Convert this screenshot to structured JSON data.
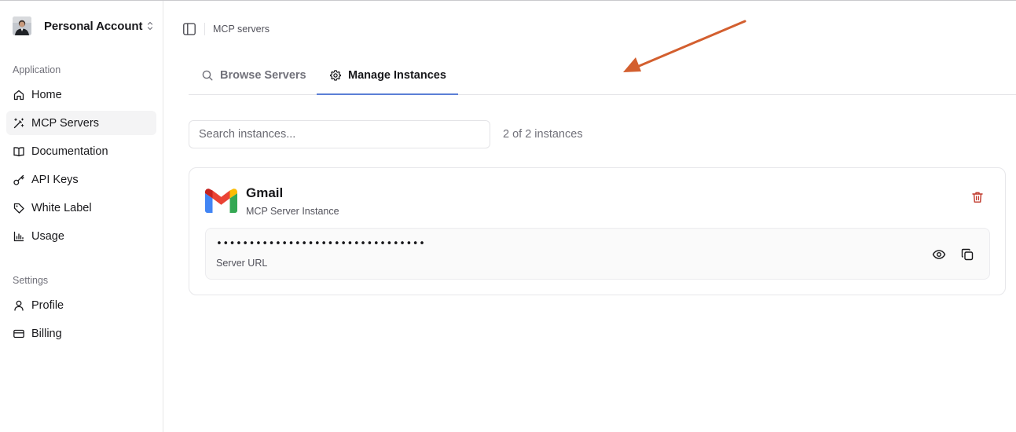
{
  "account": {
    "name": "Personal Account"
  },
  "sidebar": {
    "application_label": "Application",
    "application_items": [
      {
        "label": "Home",
        "icon": "home-icon",
        "active": false
      },
      {
        "label": "MCP Servers",
        "icon": "magic-wand-icon",
        "active": true
      },
      {
        "label": "Documentation",
        "icon": "book-open-icon",
        "active": false
      },
      {
        "label": "API Keys",
        "icon": "key-icon",
        "active": false
      },
      {
        "label": "White Label",
        "icon": "tag-icon",
        "active": false
      },
      {
        "label": "Usage",
        "icon": "bar-chart-icon",
        "active": false
      }
    ],
    "settings_label": "Settings",
    "settings_items": [
      {
        "label": "Profile",
        "icon": "user-icon",
        "active": false
      },
      {
        "label": "Billing",
        "icon": "credit-card-icon",
        "active": false
      }
    ]
  },
  "header": {
    "breadcrumb": "MCP servers"
  },
  "tabs": [
    {
      "label": "Browse Servers",
      "icon": "search-icon",
      "active": false
    },
    {
      "label": "Manage Instances",
      "icon": "gear-icon",
      "active": true
    }
  ],
  "search": {
    "placeholder": "Search instances...",
    "value": ""
  },
  "instance_count": "2 of 2 instances",
  "instance": {
    "title": "Gmail",
    "subtitle": "MCP Server Instance",
    "url_masked": "••••••••••••••••••••••••••••••••",
    "url_label": "Server URL"
  },
  "colors": {
    "accent_underline": "#5b7fd6",
    "delete_icon": "#c0392b",
    "annotation_arrow": "#d35f2f"
  }
}
